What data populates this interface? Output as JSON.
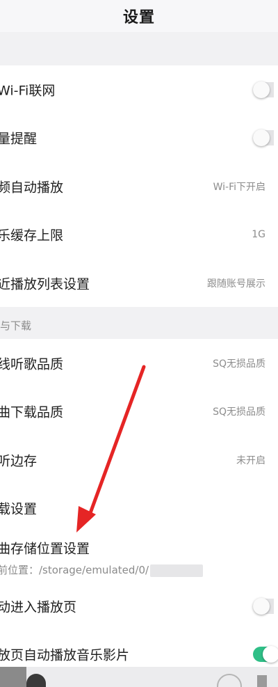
{
  "header": {
    "title": "设置"
  },
  "section_playback": {
    "rows": [
      {
        "label": "Wi-Fi联网",
        "control": "toggle",
        "on": false
      },
      {
        "label": "量提醒",
        "control": "toggle",
        "on": false
      },
      {
        "label": "频自动播放",
        "value": "Wi-Fi下开启"
      },
      {
        "label": "乐缓存上限",
        "value": "1G"
      },
      {
        "label": "近播放列表设置",
        "value": "跟随账号展示"
      }
    ]
  },
  "section_download": {
    "header": "与下载",
    "rows": [
      {
        "label": "线听歌品质",
        "value": "SQ无损品质"
      },
      {
        "label": "曲下载品质",
        "value": "SQ无损品质"
      },
      {
        "label": "听边存",
        "value": "未开启"
      },
      {
        "label": "载设置"
      },
      {
        "label": "曲存储位置设置",
        "sub": "前位置：/storage/emulated/0/"
      },
      {
        "label": "动进入播放页",
        "control": "toggle",
        "on": false
      },
      {
        "label": "放页自动播放音乐影片",
        "control": "toggle",
        "on": true
      }
    ]
  },
  "colors": {
    "toggle_on": "#2fbf87",
    "arrow": "#e52525"
  },
  "icons": {
    "annotation": "red-arrow-icon",
    "player_cover": "album-cover-icon",
    "player_play": "play-ring-icon",
    "player_list": "playlist-icon"
  }
}
